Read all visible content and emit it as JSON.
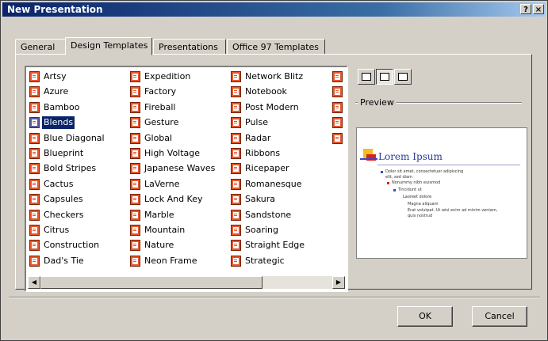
{
  "window": {
    "title": "New Presentation",
    "help_label": "?",
    "close_label": "×"
  },
  "tabs": [
    {
      "label": "General"
    },
    {
      "label": "Design Templates"
    },
    {
      "label": "Presentations"
    },
    {
      "label": "Office 97 Templates"
    }
  ],
  "templates": {
    "selected": "Blends",
    "columns": [
      [
        "Artsy",
        "Azure",
        "Bamboo",
        "Blends",
        "Blue Diagonal",
        "Blueprint",
        "Bold Stripes",
        "Cactus",
        "Capsules",
        "Checkers",
        "Citrus",
        "Construction",
        "Dad's Tie"
      ],
      [
        "Expedition",
        "Factory",
        "Fireball",
        "Gesture",
        "Global",
        "High Voltage",
        "Japanese Waves",
        "LaVerne",
        "Lock And Key",
        "Marble",
        "Mountain",
        "Nature",
        "Neon Frame"
      ],
      [
        "Network Blitz",
        "Notebook",
        "Post Modern",
        "Pulse",
        "Radar",
        "Ribbons",
        "Ricepaper",
        "Romanesque",
        "Sakura",
        "Sandstone",
        "Soaring",
        "Straight Edge",
        "Strategic"
      ],
      [
        "",
        "",
        "",
        "",
        ""
      ]
    ],
    "icon": "template-file-icon"
  },
  "view_buttons": [
    "large-icons-view-icon",
    "list-view-icon",
    "details-view-icon"
  ],
  "preview": {
    "label": "Preview",
    "slide_title": "Lorem Ipsum",
    "lines": [
      "Dolor sit amet, consectetuer adipiscing",
      "elit, sed diam",
      "Nonummy nibh euismod",
      "Tincidunt ut",
      "Laoreet dolore",
      "Magna aliquam",
      "Erat volutpat. Ut wisi enim ad minim veniam,",
      "quis nostrud"
    ],
    "colors": {
      "title": "#2a3a9a",
      "bullet_blue": "#3a4ac0",
      "bullet_red": "#e02020",
      "accent": "#f0c020"
    }
  },
  "buttons": {
    "ok": "OK",
    "cancel": "Cancel"
  }
}
